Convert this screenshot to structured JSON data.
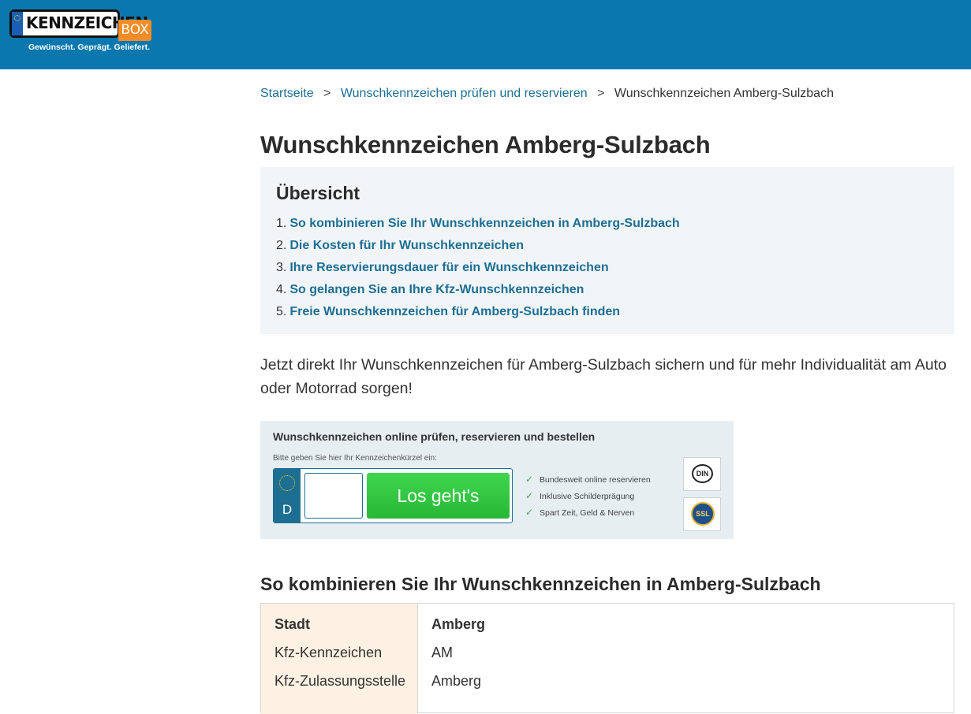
{
  "header": {
    "logo_plate_text": "KENNZEICHEN",
    "logo_box_text": "BOX",
    "slogan": "Gewünscht. Geprägt. Geliefert.",
    "background_color": "#0a78ae"
  },
  "breadcrumb": [
    {
      "label": "Startseite"
    },
    {
      "label": "Wunschkennzeichen prüfen und reservieren"
    },
    {
      "label": "Wunschkennzeichen Amberg-Sulzbach"
    }
  ],
  "breadcrumb_separator": ">",
  "page_title": "Wunschkennzeichen Amberg-Sulzbach",
  "toc": {
    "heading": "Übersicht",
    "items": [
      {
        "num": "1.",
        "label": "So kombinieren Sie Ihr Wunschkennzeichen in Amberg-Sulzbach"
      },
      {
        "num": "2.",
        "label": "Die Kosten für Ihr Wunschkennzeichen"
      },
      {
        "num": "3.",
        "label": "Ihre Reservierungsdauer für ein Wunschkennzeichen"
      },
      {
        "num": "4.",
        "label": "So gelangen Sie an Ihre Kfz-Wunschkennzeichen"
      },
      {
        "num": "5.",
        "label": "Freie Wunschkennzeichen für Amberg-Sulzbach finden"
      }
    ]
  },
  "intro": "Jetzt direkt Ihr Wunschkennzeichen für Amberg-Sulzbach sichern und für mehr Individualität am Auto oder Motorrad sorgen!",
  "widget": {
    "title": "Wunschkennzeichen online prüfen, reservieren und bestellen",
    "hint": "Bitte geben Sie hier Ihr Kennzeichenkürzel ein:",
    "country_letter": "D",
    "input_value": "",
    "button_label": "Los geht's",
    "features": [
      "Bundesweit online reservieren",
      "Inklusive Schilderprägung",
      "Spart Zeit, Geld & Nerven"
    ],
    "seal_din": "DIN",
    "seal_ssl": "SSL",
    "button_color": "#2ecc40"
  },
  "section_title": "So kombinieren Sie Ihr Wunschkennzeichen in Amberg-Sulzbach",
  "table": {
    "rows": [
      {
        "key": "Stadt",
        "value": "Amberg"
      },
      {
        "key": "Kfz-Kennzeichen",
        "value": "AM"
      },
      {
        "key": "Kfz-Zulassungsstelle",
        "value": "Amberg"
      }
    ]
  }
}
